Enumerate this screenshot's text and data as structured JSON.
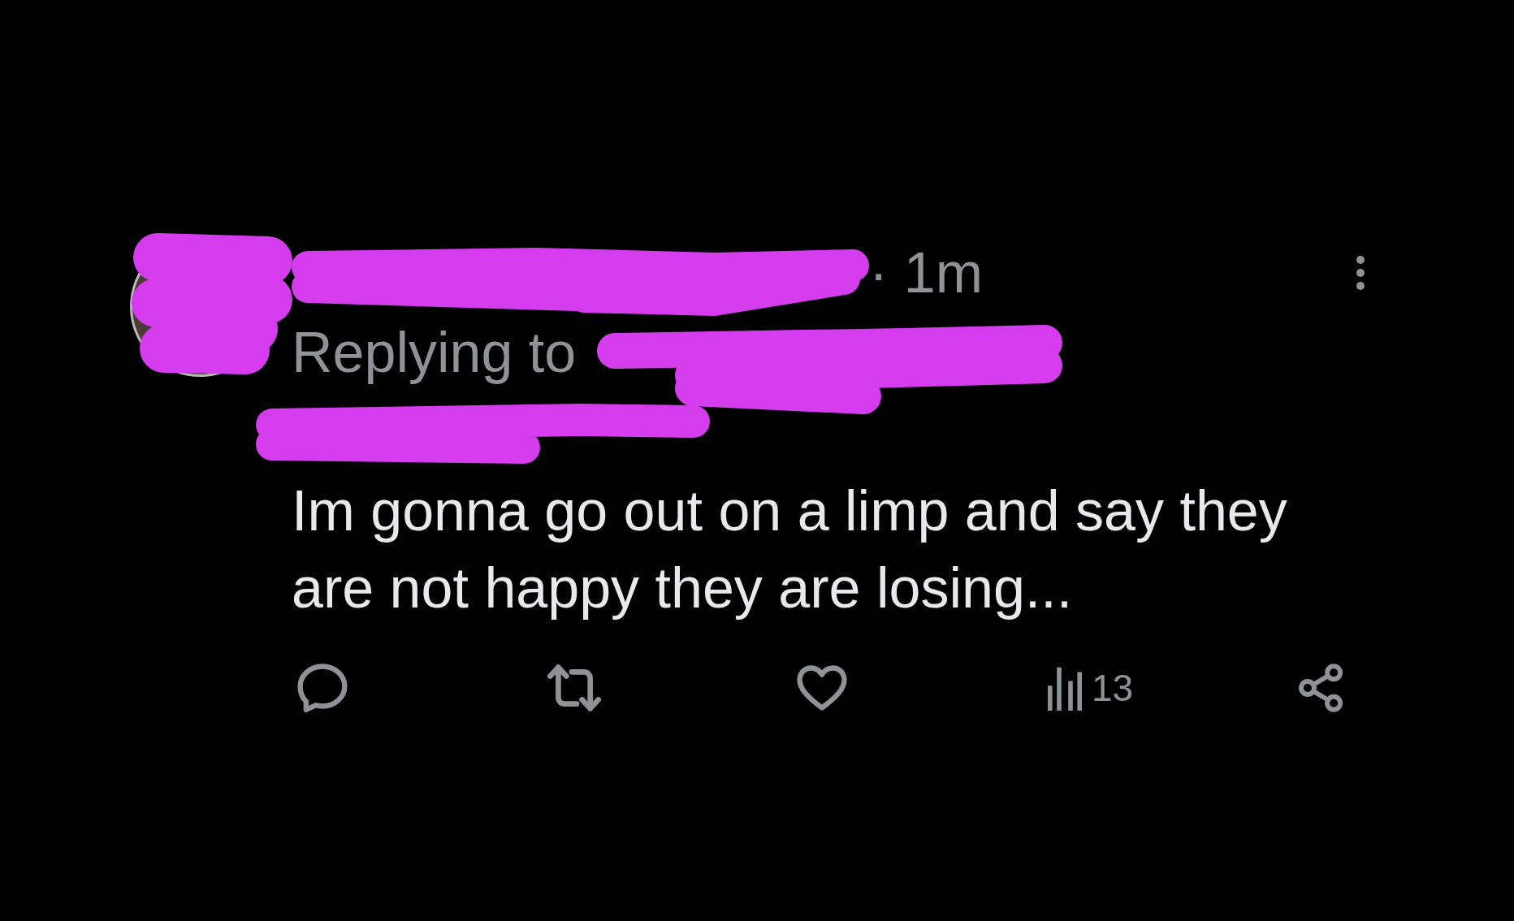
{
  "tweet": {
    "time": "· 1m",
    "replying_to": "Replying to",
    "text": "Im gonna go out on a limp and say they are not happy they are losing...",
    "actions": [
      {
        "kind": "reply"
      },
      {
        "kind": "retweet"
      },
      {
        "kind": "like"
      },
      {
        "kind": "views",
        "count": "13"
      },
      {
        "kind": "share"
      }
    ]
  }
}
